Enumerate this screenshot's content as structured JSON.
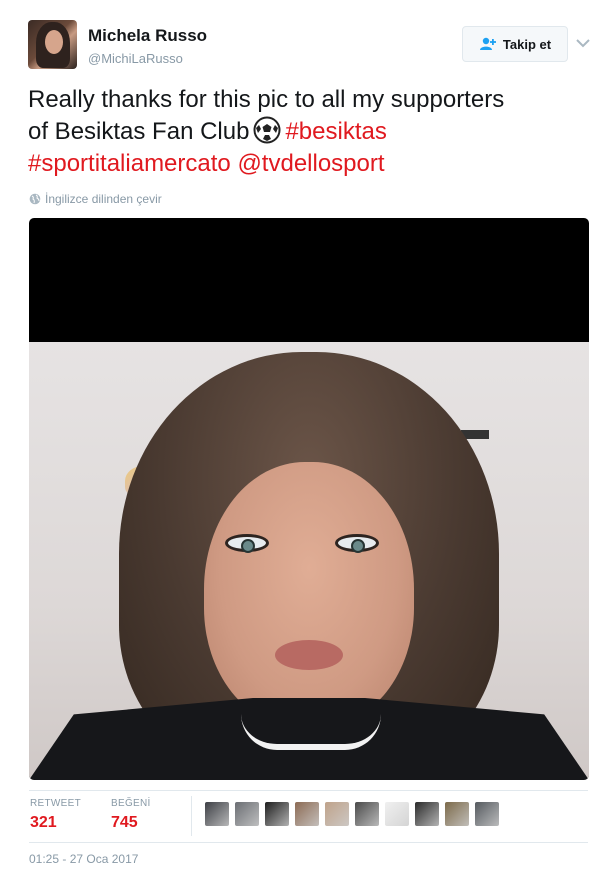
{
  "user": {
    "name": "Michela Russo",
    "handle": "@MichiLaRusso"
  },
  "follow_button": {
    "label": "Takip et"
  },
  "tweet": {
    "line1": "Really thanks for this pic to all my supporters",
    "line2_text": "of Besiktas Fan Club",
    "hashtag1": "#besiktas",
    "hashtag2": "#sportitaliamercato",
    "mention": "@tvdellosport"
  },
  "translate_label": "İngilizce dilinden çevir",
  "stats": {
    "retweet_label": "RETWEET",
    "retweet_count": "321",
    "likes_label": "BEĞENİ",
    "likes_count": "745"
  },
  "likers_colors": [
    "#3d3f45",
    "#6b6e73",
    "#1e1e1e",
    "#8c6b54",
    "#bfa28a",
    "#4a4a4a",
    "#f0f0f0",
    "#2a2a2a",
    "#7c6a4a",
    "#555a5f"
  ],
  "timestamp": "01:25 - 27 Oca 2017",
  "colors": {
    "accent": "#e0191f",
    "muted": "#8899a6",
    "text": "#14171a"
  }
}
